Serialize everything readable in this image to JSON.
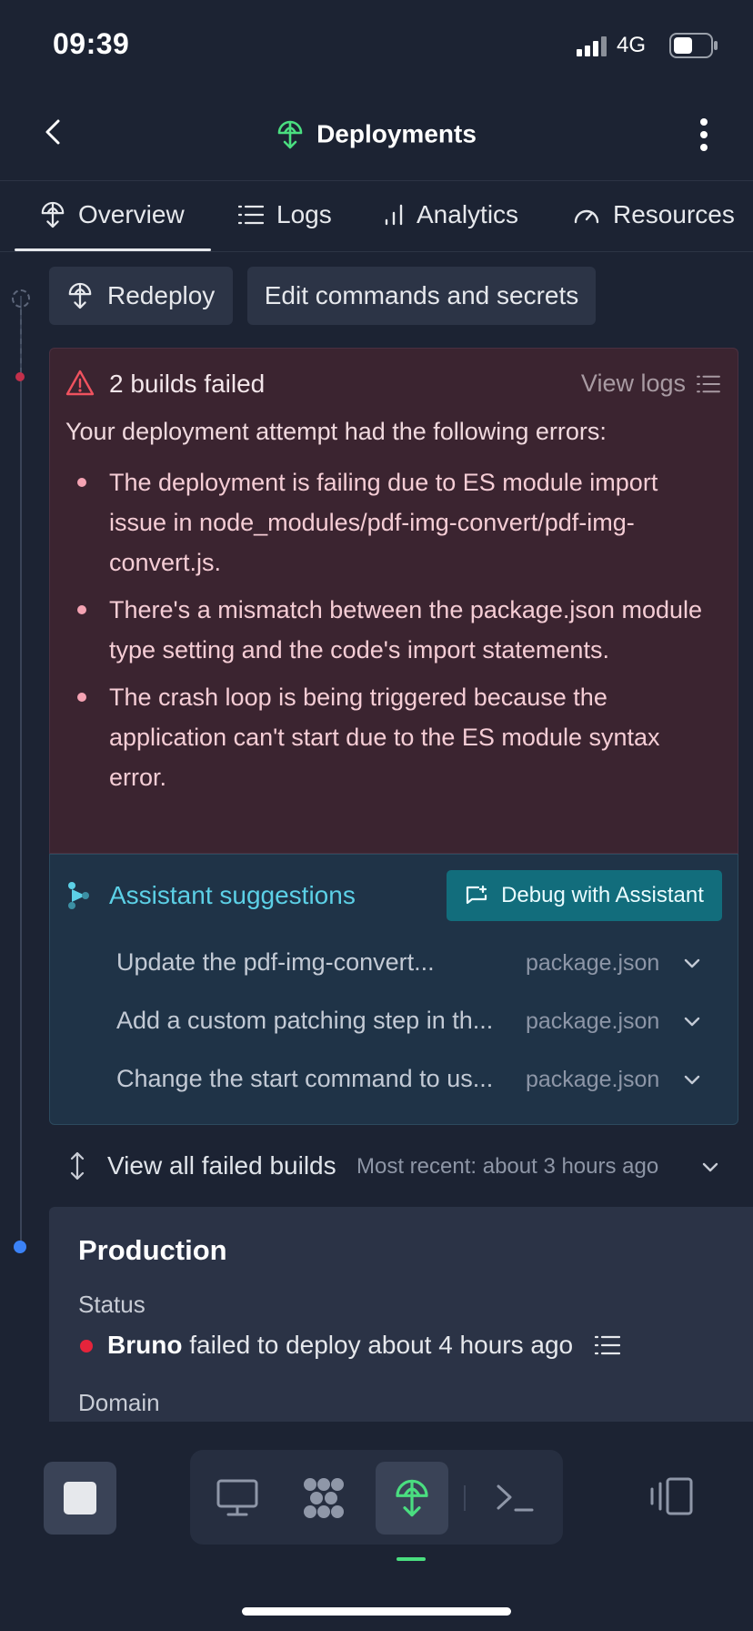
{
  "status_bar": {
    "time": "09:39",
    "network": "4G"
  },
  "header": {
    "title": "Deployments"
  },
  "tabs": [
    {
      "label": "Overview",
      "icon": "deployment-icon"
    },
    {
      "label": "Logs",
      "icon": "list-icon"
    },
    {
      "label": "Analytics",
      "icon": "bar-chart-icon"
    },
    {
      "label": "Resources",
      "icon": "gauge-icon"
    }
  ],
  "actions": {
    "redeploy": "Redeploy",
    "edit": "Edit commands and secrets"
  },
  "error_card": {
    "title": "2 builds failed",
    "view_logs": "View logs",
    "intro": "Your deployment attempt had the following errors:",
    "errors": [
      "The deployment is failing due to ES module import issue in node_modules/pdf-img-convert/pdf-img-convert.js.",
      "There's a mismatch between the package.json module type setting and the code's import statements.",
      "The crash loop is being triggered because the application can't start due to the ES module syntax error."
    ]
  },
  "assistant": {
    "title": "Assistant suggestions",
    "debug_button": "Debug with Assistant",
    "suggestions": [
      {
        "text": "Update the pdf-img-convert...",
        "file": "package.json"
      },
      {
        "text": "Add a custom patching step in th...",
        "file": "package.json"
      },
      {
        "text": "Change the start command to us...",
        "file": "package.json"
      }
    ]
  },
  "failed_builds": {
    "label": "View all failed builds",
    "recent": "Most recent: about 3 hours ago"
  },
  "production": {
    "title": "Production",
    "status_label": "Status",
    "status_user": "Bruno",
    "status_text": "failed to deploy about 4 hours ago",
    "domain_label": "Domain"
  },
  "colors": {
    "accent_green": "#4ade80",
    "error_red": "#e5243b",
    "assistant_teal": "#5cd0e6",
    "timeline_blue": "#3b82f6"
  }
}
